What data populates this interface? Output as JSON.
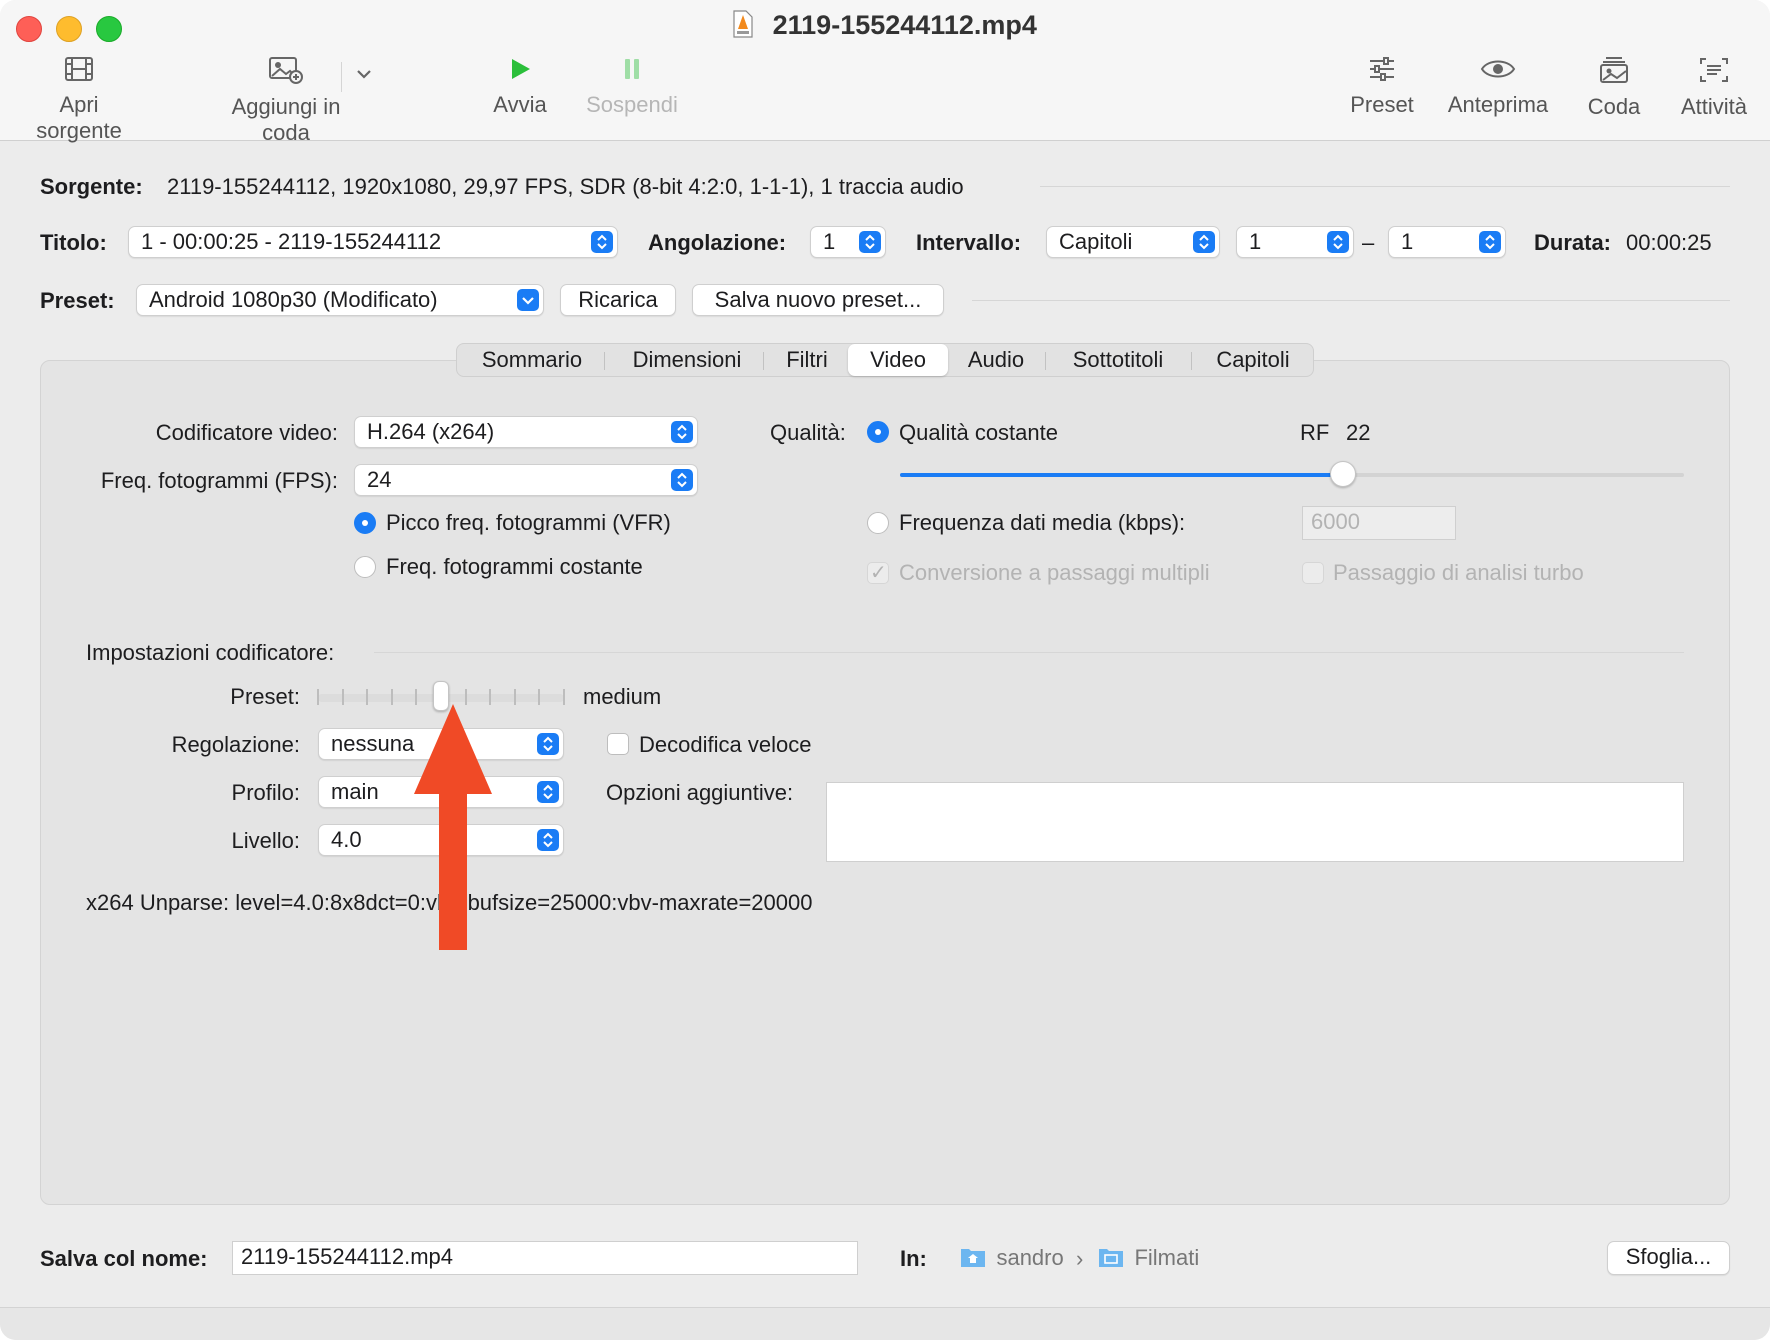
{
  "window": {
    "title": "2119-155244112.mp4"
  },
  "toolbar": {
    "open_source": "Apri sorgente",
    "add_queue": "Aggiungi in coda",
    "start": "Avvia",
    "pause": "Sospendi",
    "presets": "Preset",
    "preview": "Anteprima",
    "queue": "Coda",
    "activity": "Attività"
  },
  "source": {
    "label": "Sorgente:",
    "value": "2119-155244112, 1920x1080, 29,97 FPS, SDR (8-bit 4:2:0, 1-1-1), 1 traccia audio"
  },
  "title_row": {
    "title_label": "Titolo:",
    "title_value": "1 - 00:00:25 - 2119-155244112",
    "angle_label": "Angolazione:",
    "angle_value": "1",
    "range_label": "Intervallo:",
    "range_type": "Capitoli",
    "range_start": "1",
    "range_sep": "–",
    "range_end": "1",
    "duration_label": "Durata:",
    "duration_value": "00:00:25"
  },
  "preset_row": {
    "label": "Preset:",
    "value": "Android 1080p30 (Modificato)",
    "reload": "Ricarica",
    "save_new": "Salva nuovo preset..."
  },
  "tabs": [
    "Sommario",
    "Dimensioni",
    "Filtri",
    "Video",
    "Audio",
    "Sottotitoli",
    "Capitoli"
  ],
  "active_tab": "Video",
  "video": {
    "encoder_label": "Codificatore video:",
    "encoder_value": "H.264 (x264)",
    "fps_label": "Freq. fotogrammi (FPS):",
    "fps_value": "24",
    "vfr_label": "Picco freq. fotogrammi (VFR)",
    "cfr_label": "Freq. fotogrammi costante",
    "quality_label": "Qualità:",
    "constant_quality_label": "Qualità costante",
    "rf_label": "RF",
    "rf_value": "22",
    "rf_slider_fraction": 0.565,
    "avg_bitrate_label": "Frequenza dati media (kbps):",
    "avg_bitrate_value": "6000",
    "multipass_label": "Conversione a passaggi multipli",
    "turbo_label": "Passaggio di analisi turbo"
  },
  "encoder_settings": {
    "section_label": "Impostazioni codificatore:",
    "preset_label": "Preset:",
    "preset_value": "medium",
    "preset_slider_step": 5,
    "preset_slider_steps_total": 10,
    "tune_label": "Regolazione:",
    "tune_value": "nessuna",
    "fast_decode_label": "Decodifica veloce",
    "profile_label": "Profilo:",
    "profile_value": "main",
    "level_label": "Livello:",
    "level_value": "4.0",
    "extra_options_label": "Opzioni aggiuntive:",
    "extra_options_value": "",
    "unparse_text": "x264 Unparse: level=4.0:8x8dct=0:vbv-bufsize=25000:vbv-maxrate=20000"
  },
  "footer": {
    "save_as_label": "Salva col nome:",
    "save_as_value": "2119-155244112.mp4",
    "in_label": "In:",
    "path_1": "sandro",
    "path_sep": "›",
    "path_2": "Filmati",
    "browse": "Sfoglia..."
  },
  "colors": {
    "accent": "#1a7cf5",
    "annotation_arrow": "#f04a26",
    "play_green": "#2bbf3a"
  }
}
